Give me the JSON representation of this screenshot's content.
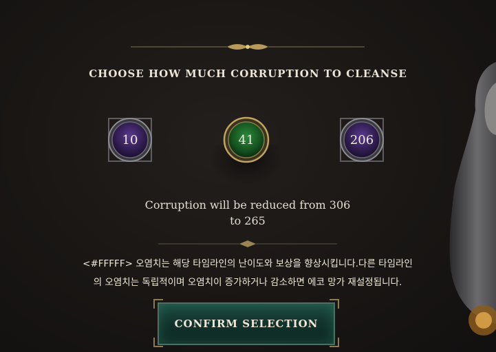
{
  "dialog": {
    "heading": "CHOOSE HOW MUCH CORRUPTION TO CLEANSE",
    "options": [
      {
        "value": "10",
        "state": "unselected",
        "color": "#4a2a78"
      },
      {
        "value": "41",
        "state": "selected",
        "color": "#1f6a2c"
      },
      {
        "value": "206",
        "state": "unselected",
        "color": "#4a2a78"
      }
    ],
    "summary_line1": "Corruption will be reduced from 306",
    "summary_line2": "to 265",
    "description_line1": "<#FFFFF> 오염치는 해당 타임라인의 난이도와 보상을 향상시킵니다.다른 타임라인",
    "description_line2": "의 오염치는 독립적이며 오염치이 증가하거나 감소하면 에코 망가 재설정됩니다.",
    "confirm_label": "CONFIRM SELECTION"
  },
  "colors": {
    "accent_gold": "#b79a5a",
    "confirm_green": "#1d4a40",
    "background": "#191614"
  }
}
